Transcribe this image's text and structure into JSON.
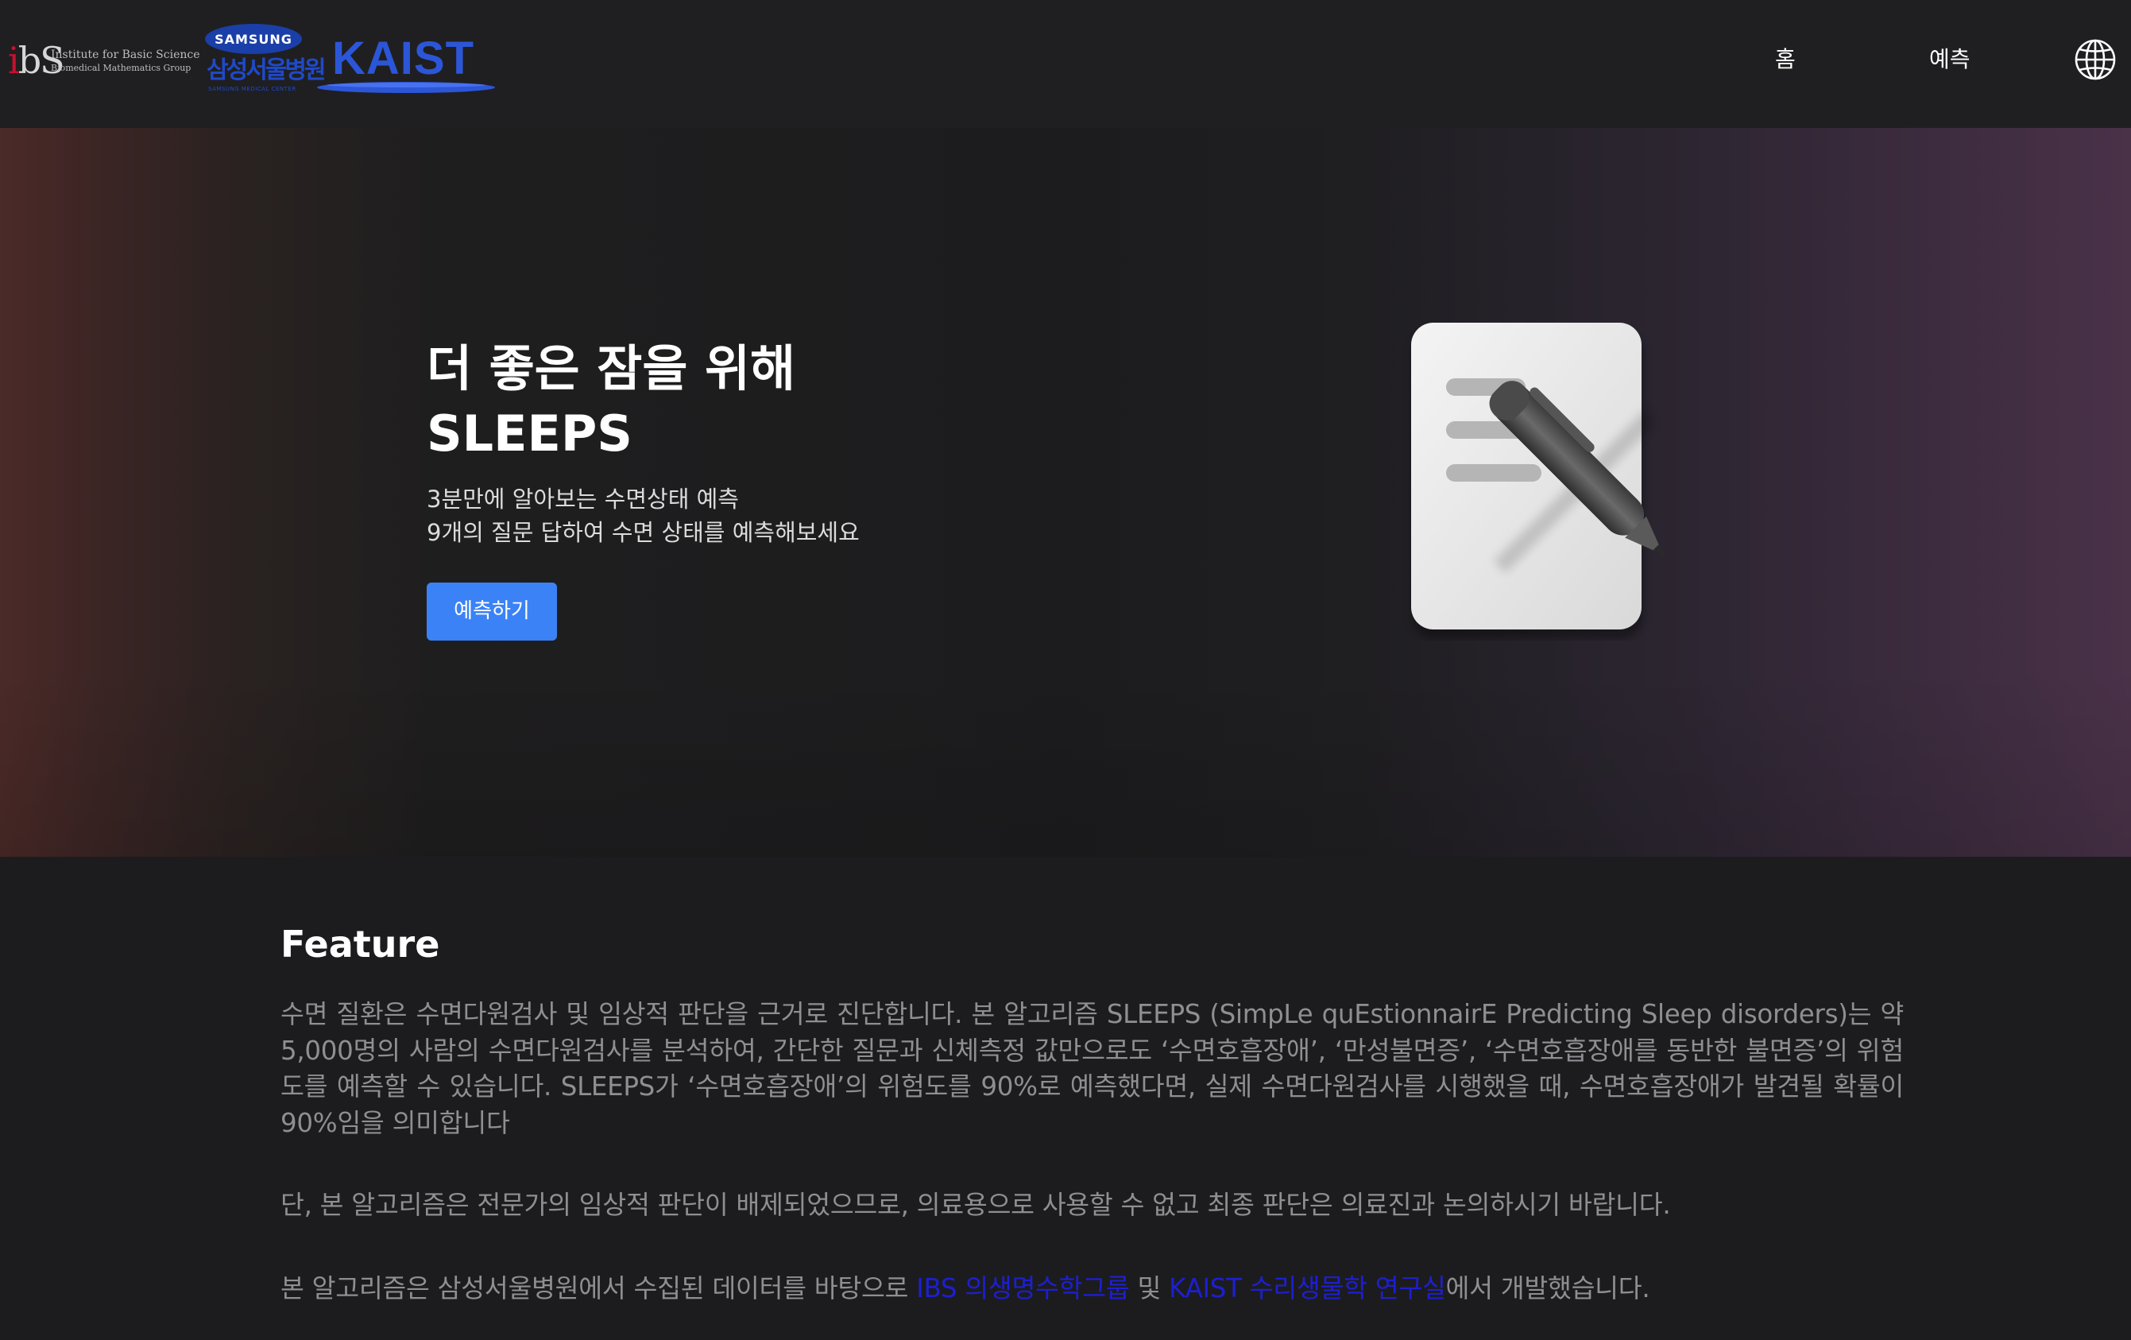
{
  "header": {
    "logos": {
      "ibs": {
        "mark": "ibs",
        "line1": "Institute for Basic Science",
        "line2": "Biomedical Mathematics Group"
      },
      "samsung": {
        "brand": "SAMSUNG",
        "korean": "삼성서울병원",
        "english": "SAMSUNG MEDICAL CENTER"
      },
      "kaist": {
        "name": "KAIST"
      }
    },
    "nav": [
      {
        "label": "홈"
      },
      {
        "label": "예측"
      }
    ],
    "language_icon": "globe-icon"
  },
  "hero": {
    "title_line1": "더 좋은 잠을 위해",
    "title_line2": "SLEEPS",
    "subtitle_line1": "3분만에 알아보는 수면상태 예측",
    "subtitle_line2": "9개의 질문 답하여 수면 상태를 예측해보세요",
    "cta_label": "예측하기",
    "illustration_icon": "document-pen-icon"
  },
  "feature": {
    "title": "Feature",
    "paragraph1": "수면 질환은 수면다원검사 및 임상적 판단을 근거로 진단합니다. 본 알고리즘 SLEEPS (SimpLe quEstionnairE Predicting Sleep disorders)는 약 5,000명의 사람의 수면다원검사를 분석하여, 간단한 질문과 신체측정 값만으로도 ‘수면호흡장애’, ‘만성불면증’, ‘수면호흡장애를 동반한 불면증’의 위험도를 예측할 수 있습니다. SLEEPS가 ‘수면호흡장애’의 위험도를 90%로 예측했다면, 실제 수면다원검사를 시행했을 때, 수면호흡장애가 발견될 확률이 90%임을 의미합니다",
    "paragraph2": "단, 본 알고리즘은 전문가의 임상적 판단이 배제되었으므로, 의료용으로 사용할 수 없고 최종 판단은 의료진과 논의하시기 바랍니다.",
    "paragraph3_prefix": "본 알고리즘은 삼성서울병원에서 수집된 데이터를 바탕으로 ",
    "link_ibs": "IBS 의생명수학그룹",
    "paragraph3_mid": " 및 ",
    "link_kaist": "KAIST 수리생물학 연구실",
    "paragraph3_suffix": "에서 개발했습니다."
  },
  "colors": {
    "background": "#1c1c1e",
    "header": "#1f1f21",
    "accent_button": "#3b82f6",
    "link": "#1d1fd1",
    "body_text": "#8e8e93"
  }
}
